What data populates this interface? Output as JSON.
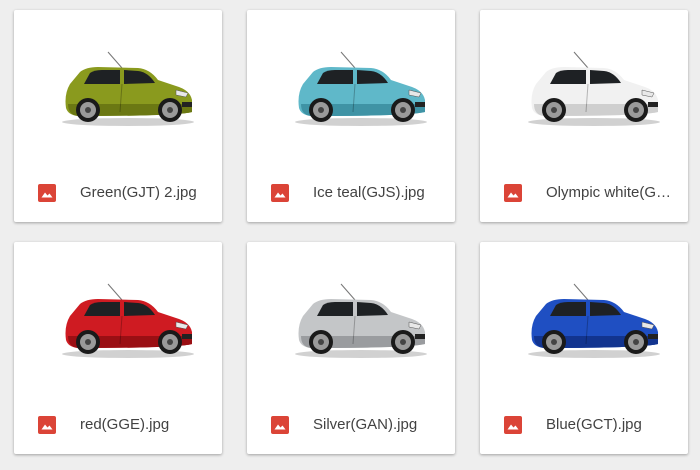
{
  "files": [
    {
      "name": "Green(GJT) 2.jpg",
      "body_color": "#8a9a1e",
      "shade_color": "#6b7813",
      "icon": "image-file-icon"
    },
    {
      "name": "Ice teal(GJS).jpg",
      "body_color": "#5fb8c9",
      "shade_color": "#3f93a5",
      "icon": "image-file-icon"
    },
    {
      "name": "Olympic white(GAZ).jpg",
      "body_color": "#f1f1f1",
      "shade_color": "#cfcfcf",
      "icon": "image-file-icon"
    },
    {
      "name": "red(GGE).jpg",
      "body_color": "#cf1b22",
      "shade_color": "#9a0f14",
      "icon": "image-file-icon"
    },
    {
      "name": "Silver(GAN).jpg",
      "body_color": "#c4c6c8",
      "shade_color": "#9a9c9f",
      "icon": "image-file-icon"
    },
    {
      "name": "Blue(GCT).jpg",
      "body_color": "#1f4fc2",
      "shade_color": "#12348f",
      "icon": "image-file-icon"
    }
  ],
  "colors": {
    "file_icon_red": "#db4437",
    "card_bg": "#ffffff",
    "page_bg": "#eeeeee"
  }
}
